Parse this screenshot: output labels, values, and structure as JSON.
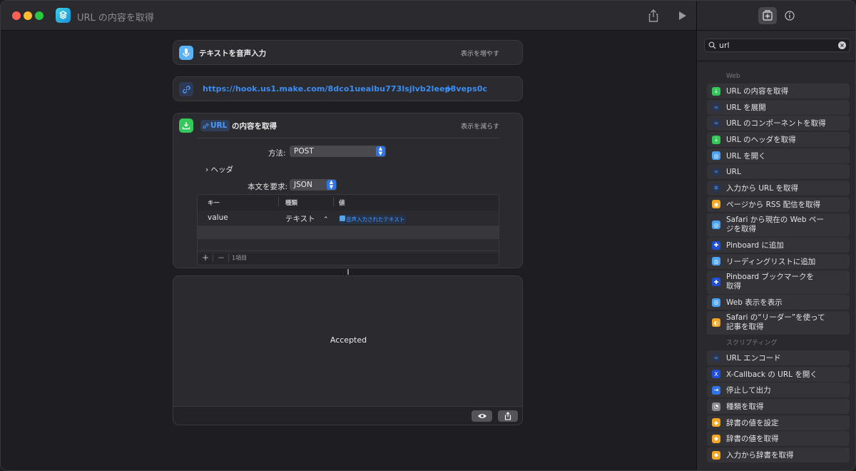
{
  "window": {
    "title": "URL の内容を取得"
  },
  "actions": {
    "dictation": {
      "label": "テキストを音声入力",
      "toggle": "表示を増やす"
    },
    "url": {
      "value": "https://hook.us1.make.com/8dco1ueaibu773lsjlvb2leep8veps0c"
    },
    "get_contents": {
      "url_token": "URL",
      "label": "の内容を取得",
      "toggle": "表示を減らす",
      "method_label": "方法:",
      "method_value": "POST",
      "headers_label": "ヘッダ",
      "body_label": "本文を要求:",
      "body_value": "JSON",
      "table": {
        "headers": [
          "キー",
          "種類",
          "値"
        ],
        "rows": [
          {
            "key": "value",
            "type": "テキスト",
            "value": "音声入力されたテキスト"
          }
        ],
        "footer_count": "1項目"
      }
    },
    "result": {
      "text": "Accepted"
    }
  },
  "sidebar": {
    "search": {
      "value": "url"
    },
    "sections": [
      {
        "title": "Web",
        "items": [
          {
            "label": "URL の内容を取得",
            "color": "#34c759",
            "icon": "download-icon"
          },
          {
            "label": "URL を展開",
            "color": "#2a3550",
            "icon": "link-icon"
          },
          {
            "label": "URL のコンポーネントを取得",
            "color": "#2a3550",
            "icon": "link-icon"
          },
          {
            "label": "URL のヘッダを取得",
            "color": "#34c759",
            "icon": "download-icon"
          },
          {
            "label": "URL を開く",
            "color": "#4aa3f5",
            "icon": "safari-icon"
          },
          {
            "label": "URL",
            "color": "#2a3550",
            "icon": "link-icon"
          },
          {
            "label": "入力から URL を取得",
            "color": "#2a3550",
            "icon": "gear-icon"
          },
          {
            "label": "ページから RSS 配信を取得",
            "color": "#f5a623",
            "icon": "rss-icon"
          },
          {
            "label": "Safari から現在の Web ペー\nジを取得",
            "color": "#4aa3f5",
            "icon": "safari-icon"
          },
          {
            "label": "Pinboard に追加",
            "color": "#1f4fd8",
            "icon": "pin-icon"
          },
          {
            "label": "リーディングリストに追加",
            "color": "#4aa3f5",
            "icon": "safari-icon"
          },
          {
            "label": "Pinboard ブックマークを\n取得",
            "color": "#1f4fd8",
            "icon": "pin-icon"
          },
          {
            "label": "Web 表示を表示",
            "color": "#4aa3f5",
            "icon": "safari-icon"
          },
          {
            "label": "Safari の“リーダー”を使って\n記事を取得",
            "color": "#f5a623",
            "icon": "reader-icon"
          }
        ]
      },
      {
        "title": "スクリプティング",
        "items": [
          {
            "label": "URL エンコード",
            "color": "#2a3550",
            "icon": "link-icon"
          },
          {
            "label": "X-Callback の URL を開く",
            "color": "#1f4fd8",
            "icon": "callback-icon"
          },
          {
            "label": "停止して出力",
            "color": "#2f74e8",
            "icon": "exit-icon"
          },
          {
            "label": "種類を取得",
            "color": "#8e8d92",
            "icon": "type-icon"
          },
          {
            "label": "辞書の値を設定",
            "color": "#f5a623",
            "icon": "dictionary-icon"
          },
          {
            "label": "辞書の値を取得",
            "color": "#f5a623",
            "icon": "dictionary-icon"
          },
          {
            "label": "入力から辞書を取得",
            "color": "#f5a623",
            "icon": "dictionary-icon"
          }
        ]
      }
    ]
  }
}
